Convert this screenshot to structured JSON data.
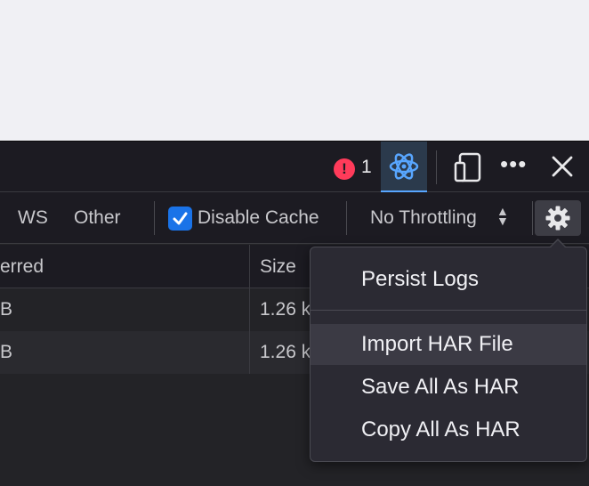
{
  "toolbox": {
    "error_count": "1",
    "error_icon_glyph": "!",
    "icons": [
      "error-icon",
      "react-atom-icon",
      "responsive-design-icon",
      "more-icon",
      "close-icon"
    ]
  },
  "filterbar": {
    "ws_label": "WS",
    "other_label": "Other",
    "disable_cache_label": "Disable Cache",
    "disable_cache_checked": true,
    "throttling_value": "No Throttling",
    "throttle_arrow": "▲\n▼"
  },
  "table": {
    "headers": [
      "erred",
      "Size"
    ],
    "rows": [
      {
        "transferred": "B",
        "size": "1.26 k"
      },
      {
        "transferred": "B",
        "size": "1.26 k"
      }
    ]
  },
  "settings_menu": {
    "items": [
      {
        "label": "Persist Logs"
      },
      {
        "label": "Import HAR File"
      },
      {
        "label": "Save All As HAR"
      },
      {
        "label": "Copy All As HAR"
      }
    ]
  },
  "colors": {
    "accent": "#1a73e8",
    "error": "#ff3b5a",
    "react_active": "#58a6ff"
  }
}
